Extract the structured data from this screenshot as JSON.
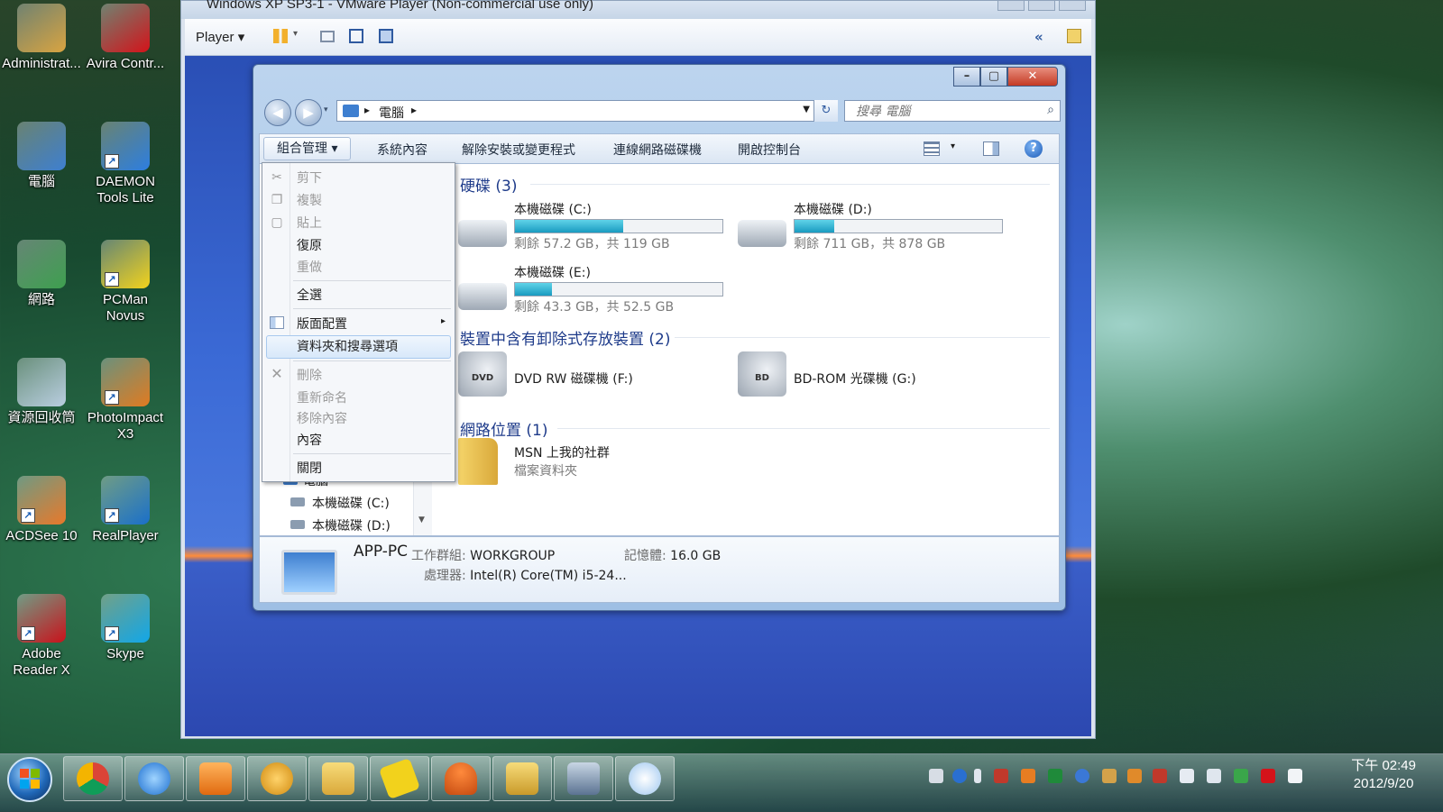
{
  "desktop": {
    "icons": [
      {
        "label": "Administrat...",
        "icon": "user-folder-icon",
        "color": "#d9a441"
      },
      {
        "label": "Avira Contr...",
        "icon": "avira-icon",
        "color": "#d4131a"
      },
      {
        "label": "電腦",
        "icon": "computer-icon",
        "color": "#3e7fd0"
      },
      {
        "label": "DAEMON Tools Lite",
        "icon": "daemon-tools-icon",
        "color": "#2d7ee0"
      },
      {
        "label": "網路",
        "icon": "network-icon",
        "color": "#3e9f4f"
      },
      {
        "label": "PCMan Novus",
        "icon": "pcman-icon",
        "color": "#f2d21c"
      },
      {
        "label": "資源回收筒",
        "icon": "recycle-bin-icon",
        "color": "#b9cde0"
      },
      {
        "label": "PhotoImpact X3",
        "icon": "photoimpact-icon",
        "color": "#e07a20"
      },
      {
        "label": "ACDSee 10",
        "icon": "acdsee-icon",
        "color": "#e8782a"
      },
      {
        "label": "RealPlayer",
        "icon": "realplayer-icon",
        "color": "#1a6fc9"
      },
      {
        "label": "Adobe Reader X",
        "icon": "adobe-reader-icon",
        "color": "#c9121b"
      },
      {
        "label": "Skype",
        "icon": "skype-icon",
        "color": "#12a7e8"
      }
    ]
  },
  "vmware": {
    "title": "Windows XP SP3-1 - VMware Player (Non-commercial use only)",
    "player_menu": "Player"
  },
  "explorer": {
    "address_crumb": "電腦",
    "search_placeholder": "搜尋 電腦",
    "commands": {
      "organize": "組合管理 ▾",
      "system_properties": "系統內容",
      "uninstall": "解除安裝或變更程式",
      "map_drive": "連線網路磁碟機",
      "control_panel": "開啟控制台"
    },
    "groups": {
      "hard_disks": "硬碟 (3)",
      "removable": "裝置中含有卸除式存放裝置 (2)",
      "network": "網路位置 (1)"
    },
    "drives": [
      {
        "name": "本機磁碟 (C:)",
        "info": "剩餘 57.2 GB，共 119 GB",
        "used_fraction": 0.52
      },
      {
        "name": "本機磁碟 (D:)",
        "info": "剩餘 711 GB，共 878 GB",
        "used_fraction": 0.19
      },
      {
        "name": "本機磁碟 (E:)",
        "info": "剩餘 43.3 GB，共 52.5 GB",
        "used_fraction": 0.18
      }
    ],
    "removable": [
      {
        "name": "DVD RW 磁碟機 (F:)",
        "badge": "DVD"
      },
      {
        "name": "BD-ROM 光碟機 (G:)",
        "badge": "BD"
      }
    ],
    "network_item": {
      "name": "MSN 上我的社群",
      "type": "檔案資料夾"
    },
    "tree": {
      "computer": "電腦",
      "c_drive": "本機磁碟 (C:)",
      "d_drive": "本機磁碟 (D:)"
    },
    "details": {
      "pc_name": "APP-PC",
      "workgroup_label": "工作群組:",
      "workgroup": "WORKGROUP",
      "memory_label": "記憶體:",
      "memory": "16.0 GB",
      "processor_label": "處理器:",
      "processor": "Intel(R) Core(TM) i5-24..."
    }
  },
  "context_menu": {
    "cut": "剪下",
    "copy": "複製",
    "paste": "貼上",
    "undo": "復原",
    "redo": "重做",
    "select_all": "全選",
    "layout": "版面配置",
    "folder_options": "資料夾和搜尋選項",
    "delete": "刪除",
    "rename": "重新命名",
    "remove_properties": "移除內容",
    "properties": "內容",
    "close": "關閉"
  },
  "taskbar": {
    "time": "下午 02:49",
    "date": "2012/9/20"
  },
  "colors": {
    "drive_fill": "#1a9bc0",
    "group_header": "#1e3b8a",
    "close_button": "#c43a24"
  }
}
